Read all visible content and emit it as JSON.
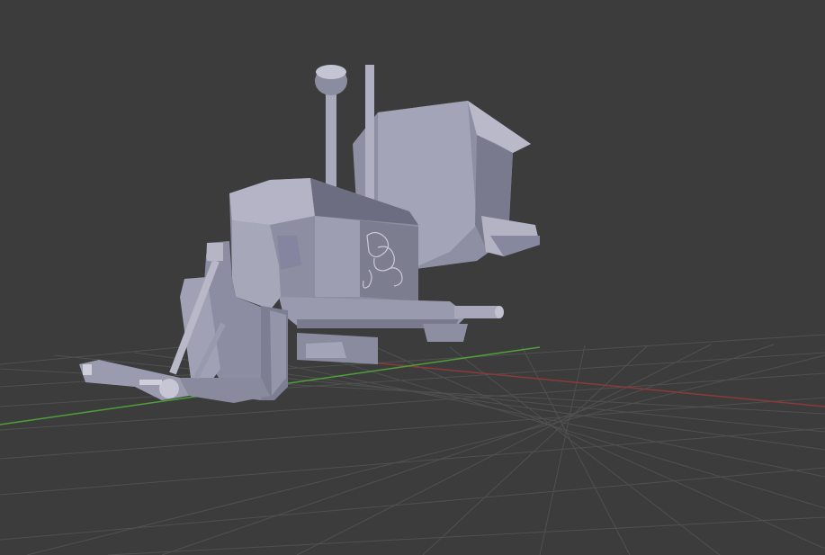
{
  "viewport": {
    "background": "#3c3c3c",
    "grid_color": "#4f4f4f",
    "x_axis_color": "#8a3a3a",
    "y_axis_color": "#4f9e3a"
  },
  "model": {
    "name_icon": "tractor-model",
    "base_color": "#9a9ab0",
    "shadow_color": "#6b6b80",
    "highlight_color": "#c9c9d6"
  }
}
